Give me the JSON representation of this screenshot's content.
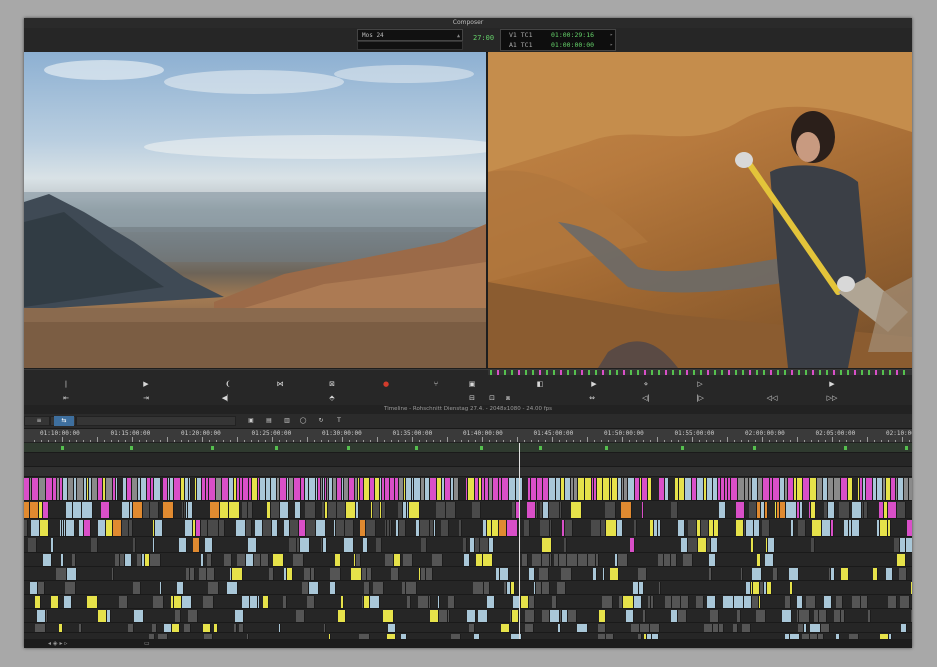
{
  "window": {
    "title": "Composer"
  },
  "composer": {
    "source_select": "Mos 24",
    "fps": "27:00",
    "timecodes": [
      {
        "label": "V1 TC1",
        "value": "01:00:29:16"
      },
      {
        "label": "A1 TC1",
        "value": "01:00:00:00"
      }
    ]
  },
  "timeline": {
    "caption": "Timeline - Rohschnitt Dienstag 27.4. - 2048x1080 - 24.00 fps",
    "ruler_labels": [
      "01:10:00:00",
      "01:15:00:00",
      "01:20:00:00",
      "01:25:00:00",
      "01:30:00:00",
      "01:35:00:00",
      "01:40:00:00",
      "01:45:00:00",
      "01:50:00:00",
      "01:55:00:00",
      "02:00:00:00",
      "02:05:00:00",
      "02:10:00"
    ]
  },
  "colors": {
    "timecode_green": "#65d26a",
    "clip_magenta": "#d94fc8",
    "clip_yellow": "#e6e24a",
    "clip_lightblue": "#a9c7d8",
    "clip_orange": "#e08a30",
    "clip_grey": "#8a8a8a"
  },
  "icons": {
    "transport_row1": [
      "mark-in-icon",
      "play-icon",
      "mark-clip-icon",
      "splice-icon",
      "replace-icon",
      "record-icon",
      "match-frame-icon",
      "lift-icon",
      "step-back-icon",
      "play-loop-icon",
      "add-edit-icon",
      "step-forward-icon",
      "play-icon"
    ],
    "transport_row2": [
      "go-to-in-icon",
      "go-to-out-icon",
      "lift-icon",
      "clear-marks-icon",
      "top-icon",
      "bottom-icon",
      "overwrite-icon",
      "extract-icon",
      "jog-back-icon",
      "jog-forward-icon",
      "rewind-icon",
      "fast-forward-icon"
    ]
  }
}
